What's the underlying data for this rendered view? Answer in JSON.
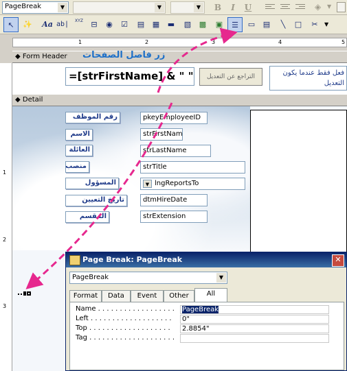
{
  "format_toolbar": {
    "object_combo": "PageBreak",
    "bold": "B",
    "italic": "I",
    "underline": "U"
  },
  "toolbox": {
    "label_tool": "Aa",
    "textbox_tool": "ab|",
    "togglebutton_tool": "XYZ"
  },
  "ruler": {
    "h_numbers": [
      "1",
      "2",
      "3",
      "4",
      "5"
    ],
    "v_numbers": [
      "1",
      "2",
      "3"
    ]
  },
  "sections": {
    "form_header": "Form Header",
    "detail": "Detail"
  },
  "header": {
    "title_ar": "زر فاصل الصفحات",
    "expression": "=[strFirstName] & \" \" &",
    "undo_button": "التراجع عن التعديل",
    "note_ar": "فعل فقط عندما يكون التعديل"
  },
  "fields": [
    {
      "label": "رقم الموظف",
      "value": "pkeyEmployeeID"
    },
    {
      "label": "الاسم",
      "value": "strFirstNam"
    },
    {
      "label": "العائلة",
      "value": "strLastName"
    },
    {
      "label": "منصب",
      "value": "strTitle"
    },
    {
      "label": "المسؤول",
      "value": "lngReportsTo"
    },
    {
      "label": "تاريخ التعيين",
      "value": "dtmHireDate"
    },
    {
      "label": "المقسم",
      "value": "strExtension"
    }
  ],
  "property_sheet": {
    "title": "Page Break: PageBreak",
    "close": "✕",
    "object": "PageBreak",
    "tabs": [
      "Format",
      "Data",
      "Event",
      "Other",
      "All"
    ],
    "active_tab": "All",
    "rows": [
      {
        "name": "Name . . . . . . . . . . . . . . . . . .",
        "value": "PageBreak"
      },
      {
        "name": "Left . . . . . . . . . . . . . . . . . . .",
        "value": "0\""
      },
      {
        "name": "Top . . . . . . . . . . . . . . . . . . .",
        "value": "2.8854\""
      },
      {
        "name": "Tag . . . . . . . . . . . . . . . . . . . .",
        "value": ""
      }
    ]
  },
  "colors": {
    "arrow": "#e6288e",
    "selection": "#0a246a",
    "label_text": "#1f3b8a"
  }
}
